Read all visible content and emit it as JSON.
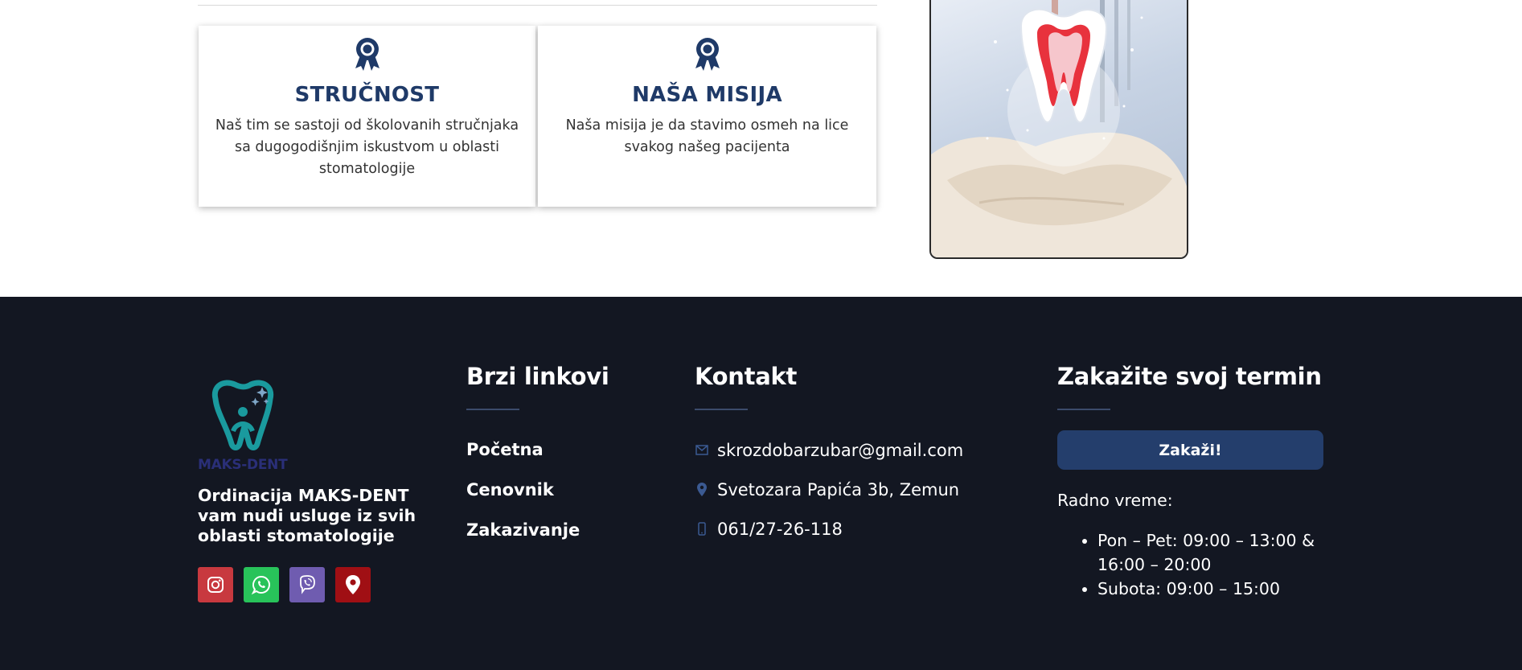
{
  "features": [
    {
      "title": "STRUČNOST",
      "text": "Naš tim se sastoji od školovanih stručnjaka sa dugogodišnjim iskustvom u oblasti stomatologije",
      "icon": "award-icon"
    },
    {
      "title": "NAŠA MISIJA",
      "text": "Naša misija je da stavimo osmeh na lice svakog našeg pacijenta",
      "icon": "award-icon"
    }
  ],
  "footer": {
    "logo_text": "MAKS-DENT",
    "description": "Ordinacija MAKS-DENT vam nudi usluge iz svih oblasti stomatologije",
    "social": [
      "instagram-icon",
      "whatsapp-icon",
      "viber-icon",
      "map-pin-icon"
    ],
    "quick_links": {
      "title": "Brzi linkovi",
      "items": [
        "Početna",
        "Cenovnik",
        "Zakazivanje"
      ]
    },
    "contact": {
      "title": "Kontakt",
      "email": "skrozdobarzubar@gmail.com",
      "address": "Svetozara Papića 3b, Zemun",
      "phone": "061/27-26-118"
    },
    "booking": {
      "title": "Zakažite svoj termin",
      "button": "Zakaži!",
      "hours_label": "Radno vreme:",
      "hours": [
        "Pon – Pet: 09:00 – 13:00 & 16:00 – 20:00",
        "Subota: 09:00 – 15:00"
      ]
    }
  },
  "colors": {
    "brand_navy": "#1f3a68",
    "footer_bg": "#131722",
    "button_bg": "#243e6c",
    "logo_teal": "#1a9a9e"
  }
}
